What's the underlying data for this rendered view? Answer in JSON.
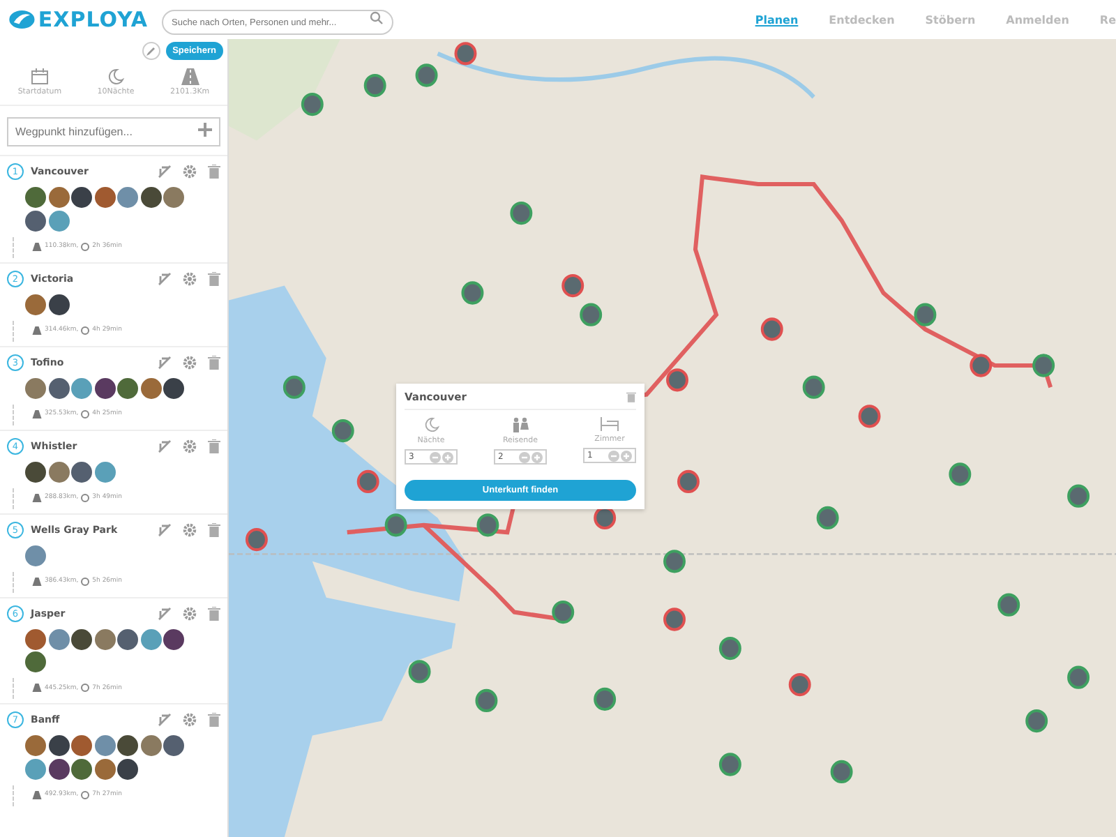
{
  "header": {
    "logo": "EXPLOYA",
    "search": {
      "placeholder": "Suche nach Orten, Personen und mehr..."
    },
    "nav": [
      {
        "label": "Planen",
        "selected": true
      },
      {
        "label": "Entdecken",
        "selected": false
      },
      {
        "label": "Stöbern",
        "selected": false
      },
      {
        "label": "Anmelden",
        "selected": false
      },
      {
        "label": "Re",
        "selected": false
      }
    ]
  },
  "sidebar": {
    "save_button": "Speichern",
    "stats": [
      {
        "kind": "calendar",
        "label": "Startdatum"
      },
      {
        "kind": "moon",
        "label": "10Nächte"
      },
      {
        "kind": "road",
        "label": "2101.3Km"
      }
    ],
    "waypoint_input": {
      "placeholder": "Wegpunkt hinzufügen..."
    },
    "waypoints": [
      {
        "number": "1",
        "name": "Vancouver",
        "photos": [
          {
            "kind": "photo"
          },
          {
            "kind": "photo"
          },
          {
            "kind": "photo"
          },
          {
            "kind": "photo"
          },
          {
            "kind": "photo"
          },
          {
            "kind": "photo"
          },
          {
            "kind": "photo"
          },
          {
            "kind": "photo"
          },
          {
            "kind": "photo"
          }
        ],
        "distance": "110.38km,",
        "duration": "2h 36min"
      },
      {
        "number": "2",
        "name": "Victoria",
        "photos": [
          {
            "kind": "photo"
          },
          {
            "kind": "photo"
          }
        ],
        "distance": "314.46km,",
        "duration": "4h 29min"
      },
      {
        "number": "3",
        "name": "Tofino",
        "photos": [
          {
            "kind": "photo"
          },
          {
            "kind": "photo"
          },
          {
            "kind": "photo"
          },
          {
            "kind": "photo"
          },
          {
            "kind": "photo"
          },
          {
            "kind": "photo"
          },
          {
            "kind": "photo"
          }
        ],
        "distance": "325.53km,",
        "duration": "4h 25min"
      },
      {
        "number": "4",
        "name": "Whistler",
        "photos": [
          {
            "kind": "photo"
          },
          {
            "kind": "photo"
          },
          {
            "kind": "photo"
          },
          {
            "kind": "photo"
          }
        ],
        "distance": "288.83km,",
        "duration": "3h 49min"
      },
      {
        "number": "5",
        "name": "Wells Gray Park",
        "photos": [
          {
            "kind": "photo"
          }
        ],
        "distance": "386.43km,",
        "duration": "5h 26min"
      },
      {
        "number": "6",
        "name": "Jasper",
        "photos": [
          {
            "kind": "photo"
          },
          {
            "kind": "photo"
          },
          {
            "kind": "photo"
          },
          {
            "kind": "photo"
          },
          {
            "kind": "photo"
          },
          {
            "kind": "photo"
          },
          {
            "kind": "photo"
          },
          {
            "kind": "photo"
          }
        ],
        "distance": "445.25km,",
        "duration": "7h 26min"
      },
      {
        "number": "7",
        "name": "Banff",
        "photos": [
          {
            "kind": "photo"
          },
          {
            "kind": "photo"
          },
          {
            "kind": "photo"
          },
          {
            "kind": "photo"
          },
          {
            "kind": "photo"
          },
          {
            "kind": "photo"
          },
          {
            "kind": "photo"
          },
          {
            "kind": "photo"
          },
          {
            "kind": "photo"
          },
          {
            "kind": "photo"
          },
          {
            "kind": "photo"
          },
          {
            "kind": "photo"
          }
        ],
        "distance": "492.93km,",
        "duration": "7h 27min"
      }
    ]
  },
  "popup": {
    "title": "Vancouver",
    "fields": [
      {
        "kind": "moon",
        "label": "Nächte",
        "value": "3"
      },
      {
        "kind": "people",
        "label": "Reisende",
        "value": "2"
      },
      {
        "kind": "bed",
        "label": "Zimmer",
        "value": "1"
      }
    ],
    "button": "Unterkunft finden"
  }
}
